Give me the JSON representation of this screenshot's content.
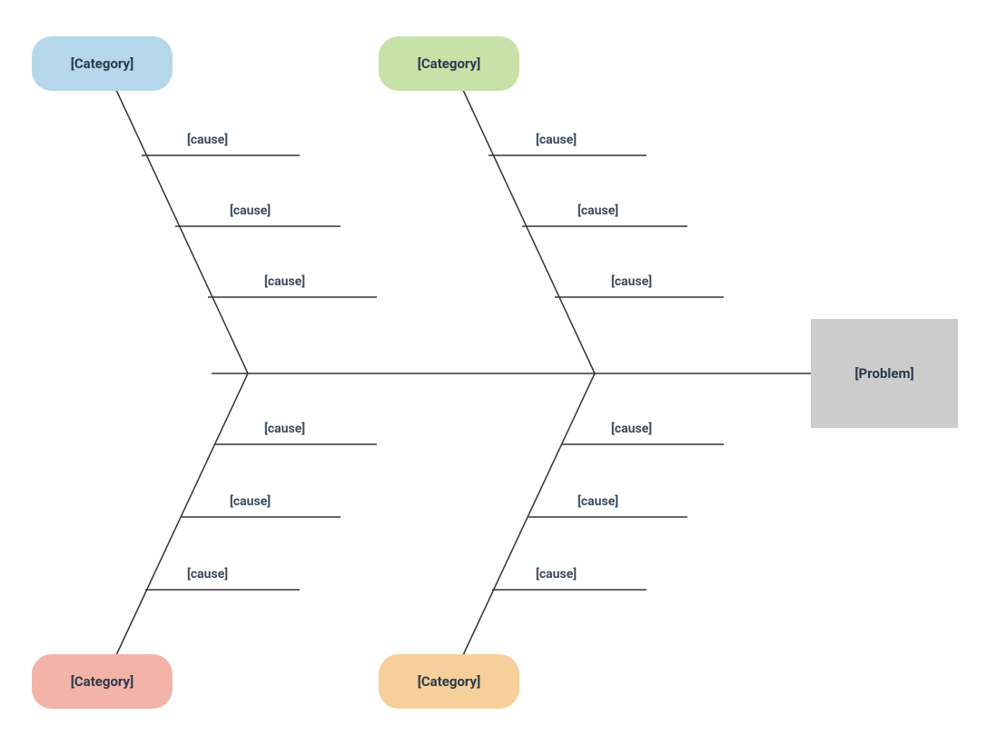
{
  "diagram": {
    "type": "fishbone",
    "problem": {
      "label": "[Problem]"
    },
    "categories": [
      {
        "id": "top-left",
        "position": "top-left",
        "label": "[Category]",
        "color": "#b5d7e9",
        "causes": [
          {
            "label": "[cause]"
          },
          {
            "label": "[cause]"
          },
          {
            "label": "[cause]"
          }
        ]
      },
      {
        "id": "top-right",
        "position": "top-right",
        "label": "[Category]",
        "color": "#c7e1a9",
        "causes": [
          {
            "label": "[cause]"
          },
          {
            "label": "[cause]"
          },
          {
            "label": "[cause]"
          }
        ]
      },
      {
        "id": "bottom-left",
        "position": "bottom-left",
        "label": "[Category]",
        "color": "#f3b3a8",
        "causes": [
          {
            "label": "[cause]"
          },
          {
            "label": "[cause]"
          },
          {
            "label": "[cause]"
          }
        ]
      },
      {
        "id": "bottom-right",
        "position": "bottom-right",
        "label": "[Category]",
        "color": "#f6cf9a",
        "causes": [
          {
            "label": "[cause]"
          },
          {
            "label": "[cause]"
          },
          {
            "label": "[cause]"
          }
        ]
      }
    ]
  }
}
